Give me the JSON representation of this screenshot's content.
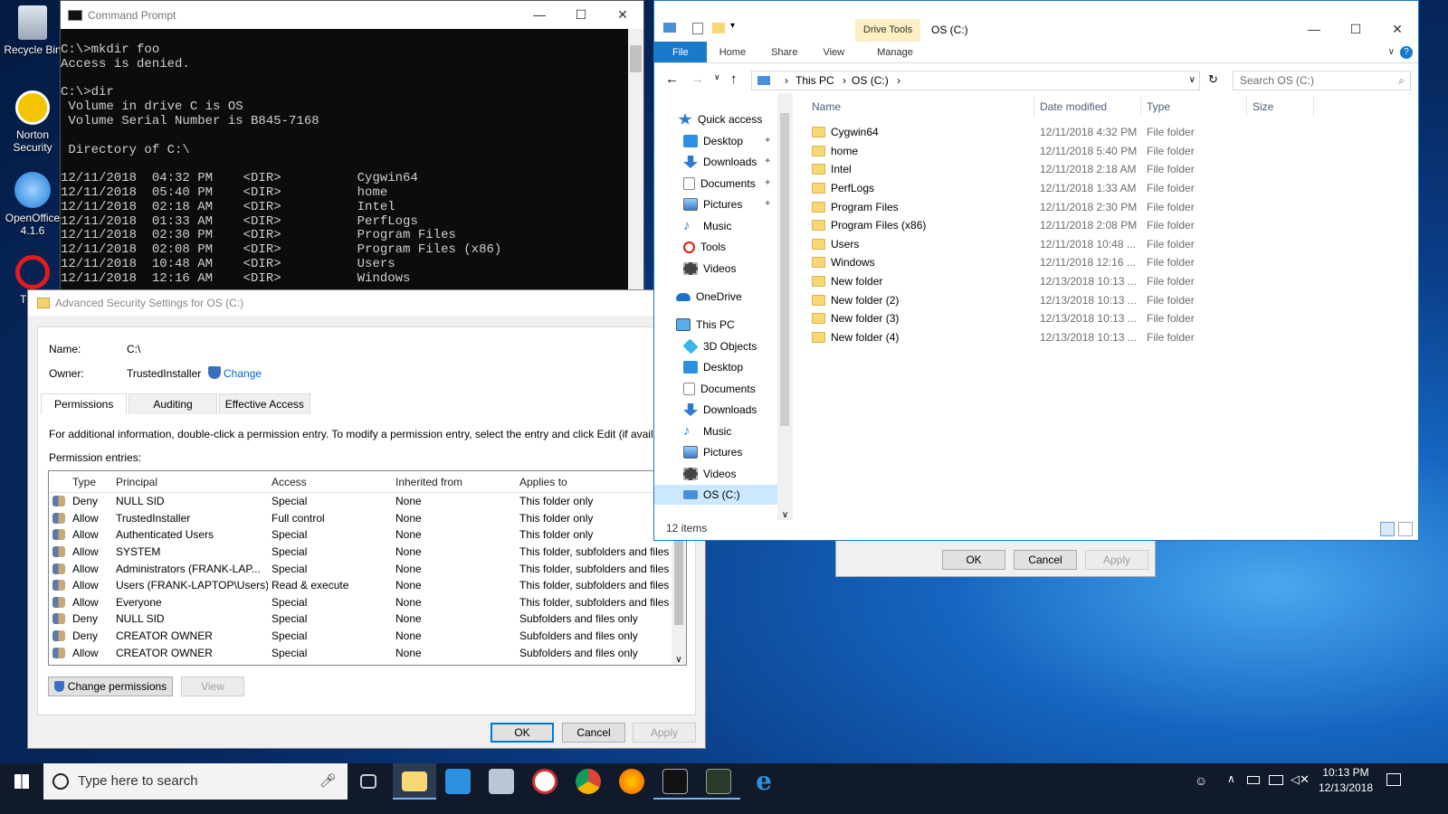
{
  "desktop": {
    "icons": [
      {
        "label": "Recycle Bin"
      },
      {
        "label": "Norton Security"
      },
      {
        "label": "OpenOffice 4.1.6"
      },
      {
        "label": "T"
      }
    ]
  },
  "cmd": {
    "title": "Command Prompt",
    "output": "C:\\>mkdir foo\nAccess is denied.\n\nC:\\>dir\n Volume in drive C is OS\n Volume Serial Number is B845-7168\n\n Directory of C:\\\n\n12/11/2018  04:32 PM    <DIR>          Cygwin64\n12/11/2018  05:40 PM    <DIR>          home\n12/11/2018  02:18 AM    <DIR>          Intel\n12/11/2018  01:33 AM    <DIR>          PerfLogs\n12/11/2018  02:30 PM    <DIR>          Program Files\n12/11/2018  02:08 PM    <DIR>          Program Files (x86)\n12/11/2018  10:48 AM    <DIR>          Users\n12/11/2018  12:16 AM    <DIR>          Windows"
  },
  "security": {
    "title": "Advanced Security Settings for OS (C:)",
    "name_label": "Name:",
    "name_value": "C:\\",
    "owner_label": "Owner:",
    "owner_value": "TrustedInstaller",
    "change_link": "Change",
    "tabs": [
      "Permissions",
      "Auditing",
      "Effective Access"
    ],
    "info_text": "For additional information, double-click a permission entry. To modify a permission entry, select the entry and click Edit (if availab",
    "entries_label": "Permission entries:",
    "columns": [
      "Type",
      "Principal",
      "Access",
      "Inherited from",
      "Applies to"
    ],
    "rows": [
      [
        "Deny",
        "NULL SID",
        "Special",
        "None",
        "This folder only"
      ],
      [
        "Allow",
        "TrustedInstaller",
        "Full control",
        "None",
        "This folder only"
      ],
      [
        "Allow",
        "Authenticated Users",
        "Special",
        "None",
        "This folder only"
      ],
      [
        "Allow",
        "SYSTEM",
        "Special",
        "None",
        "This folder, subfolders and files"
      ],
      [
        "Allow",
        "Administrators (FRANK-LAP...",
        "Special",
        "None",
        "This folder, subfolders and files"
      ],
      [
        "Allow",
        "Users (FRANK-LAPTOP\\Users)",
        "Read & execute",
        "None",
        "This folder, subfolders and files"
      ],
      [
        "Allow",
        "Everyone",
        "Special",
        "None",
        "This folder, subfolders and files"
      ],
      [
        "Deny",
        "NULL SID",
        "Special",
        "None",
        "Subfolders and files only"
      ],
      [
        "Deny",
        "CREATOR OWNER",
        "Special",
        "None",
        "Subfolders and files only"
      ],
      [
        "Allow",
        "CREATOR OWNER",
        "Special",
        "None",
        "Subfolders and files only"
      ]
    ],
    "change_permissions": "Change permissions",
    "view": "View",
    "ok": "OK",
    "cancel": "Cancel",
    "apply": "Apply"
  },
  "dialog2": {
    "ok": "OK",
    "cancel": "Cancel",
    "apply": "Apply"
  },
  "explorer": {
    "title": "OS (C:)",
    "drive_tools": "Drive Tools",
    "ribbon_tabs": [
      "File",
      "Home",
      "Share",
      "View",
      "Manage"
    ],
    "breadcrumb": [
      "This PC",
      "OS (C:)"
    ],
    "search_placeholder": "Search OS (C:)",
    "nav": {
      "quick_access": "Quick access",
      "quick_items": [
        "Desktop",
        "Downloads",
        "Documents",
        "Pictures",
        "Music",
        "Tools",
        "Videos"
      ],
      "onedrive": "OneDrive",
      "this_pc": "This PC",
      "pc_items": [
        "3D Objects",
        "Desktop",
        "Documents",
        "Downloads",
        "Music",
        "Pictures",
        "Videos",
        "OS (C:)"
      ]
    },
    "columns": [
      "Name",
      "Date modified",
      "Type",
      "Size"
    ],
    "files": [
      {
        "name": "Cygwin64",
        "date": "12/11/2018 4:32 PM",
        "type": "File folder"
      },
      {
        "name": "home",
        "date": "12/11/2018 5:40 PM",
        "type": "File folder"
      },
      {
        "name": "Intel",
        "date": "12/11/2018 2:18 AM",
        "type": "File folder"
      },
      {
        "name": "PerfLogs",
        "date": "12/11/2018 1:33 AM",
        "type": "File folder"
      },
      {
        "name": "Program Files",
        "date": "12/11/2018 2:30 PM",
        "type": "File folder"
      },
      {
        "name": "Program Files (x86)",
        "date": "12/11/2018 2:08 PM",
        "type": "File folder"
      },
      {
        "name": "Users",
        "date": "12/11/2018 10:48 ...",
        "type": "File folder"
      },
      {
        "name": "Windows",
        "date": "12/11/2018 12:16 ...",
        "type": "File folder"
      },
      {
        "name": "New folder",
        "date": "12/13/2018 10:13 ...",
        "type": "File folder"
      },
      {
        "name": "New folder (2)",
        "date": "12/13/2018 10:13 ...",
        "type": "File folder"
      },
      {
        "name": "New folder (3)",
        "date": "12/13/2018 10:13 ...",
        "type": "File folder"
      },
      {
        "name": "New folder (4)",
        "date": "12/13/2018 10:13 ...",
        "type": "File folder"
      }
    ],
    "status": "12 items"
  },
  "taskbar": {
    "search_placeholder": "Type here to search",
    "time": "10:13 PM",
    "date": "12/13/2018"
  }
}
